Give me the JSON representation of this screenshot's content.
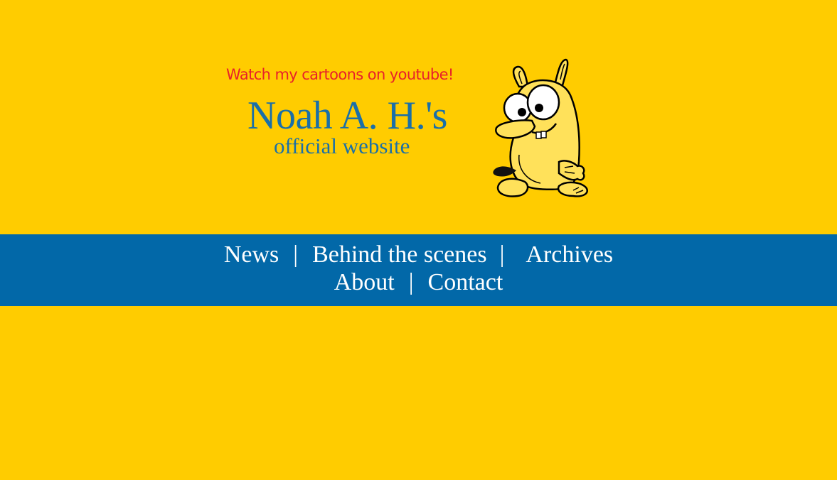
{
  "header": {
    "youtube_link": "Watch my cartoons on youtube!",
    "title": "Noah A. H.'s",
    "subtitle": "official website"
  },
  "nav": {
    "row1": [
      {
        "label": "News"
      },
      {
        "label": "Behind the scenes"
      },
      {
        "label": "Archives"
      }
    ],
    "row2": [
      {
        "label": "About"
      },
      {
        "label": "Contact"
      }
    ],
    "separator": "|"
  },
  "colors": {
    "background": "#FFCC00",
    "navbar": "#0268A8",
    "title": "#1A6FA8",
    "youtube_link": "#E8202A",
    "nav_text": "#FFFFFF"
  },
  "icons": {
    "mascot": "yellow-cartoon-creature"
  }
}
